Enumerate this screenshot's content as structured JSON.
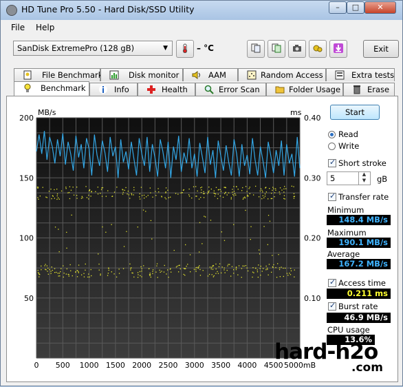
{
  "window": {
    "title": "HD Tune Pro 5.50 - Hard Disk/SSD Utility"
  },
  "menu": {
    "file": "File",
    "help": "Help"
  },
  "toolbar": {
    "drive": "SanDisk ExtremePro (128 gB)",
    "temperature": "– °C",
    "exit_label": "Exit",
    "icons": [
      "thermometer-icon",
      "copy-icon",
      "copy-info-icon",
      "camera-icon",
      "options-icon",
      "save-icon"
    ]
  },
  "tabs": {
    "row1": [
      {
        "label": "File Benchmark",
        "icon": "file-benchmark-icon"
      },
      {
        "label": "Disk monitor",
        "icon": "disk-monitor-icon"
      },
      {
        "label": "AAM",
        "icon": "speaker-icon"
      },
      {
        "label": "Random Access",
        "icon": "random-access-icon"
      },
      {
        "label": "Extra tests",
        "icon": "extra-tests-icon"
      }
    ],
    "row2": [
      {
        "label": "Benchmark",
        "icon": "benchmark-icon",
        "active": true
      },
      {
        "label": "Info",
        "icon": "info-icon"
      },
      {
        "label": "Health",
        "icon": "health-icon"
      },
      {
        "label": "Error Scan",
        "icon": "error-scan-icon"
      },
      {
        "label": "Folder Usage",
        "icon": "folder-icon"
      },
      {
        "label": "Erase",
        "icon": "erase-icon"
      }
    ]
  },
  "controls": {
    "start_label": "Start",
    "read_label": "Read",
    "write_label": "Write",
    "mode": "read",
    "short_stroke_label": "Short stroke",
    "short_stroke_checked": true,
    "short_stroke_value": "5",
    "short_stroke_unit": "gB",
    "transfer_rate_label": "Transfer rate",
    "transfer_rate_checked": true,
    "access_time_label": "Access time",
    "access_time_checked": true,
    "burst_rate_label": "Burst rate",
    "burst_rate_checked": true
  },
  "results": {
    "minimum_label": "Minimum",
    "minimum": "148.4 MB/s",
    "maximum_label": "Maximum",
    "maximum": "190.1 MB/s",
    "average_label": "Average",
    "average": "167.2 MB/s",
    "access_time": "0.211 ms",
    "burst_rate": "46.9 MB/s",
    "cpu_usage_label": "CPU usage",
    "cpu_usage": "13.6%"
  },
  "watermark": {
    "main": "hard-h2o",
    "sub": ".com"
  },
  "colors": {
    "transfer_line": "#33a7e6",
    "access_dots": "#e6e62e",
    "plot_bg_top": "#0f0f0f",
    "plot_bg_bottom": "#3c3c3c"
  },
  "chart_data": {
    "type": "line",
    "ylabel_left": "MB/s",
    "ylabel_right": "ms",
    "xlabel_unit": "mB",
    "x_ticks": [
      "0",
      "500",
      "1000",
      "1500",
      "2000",
      "2500",
      "3000",
      "3500",
      "4000",
      "4500",
      "5000mB"
    ],
    "y_left_ticks": [
      "200",
      "150",
      "100",
      "50"
    ],
    "y_right_ticks": [
      "0.40",
      "0.30",
      "0.20",
      "0.10"
    ],
    "xlim": [
      0,
      5000
    ],
    "ylim_left": [
      0,
      200
    ],
    "ylim_right": [
      0,
      0.4
    ],
    "grid": true,
    "series": [
      {
        "name": "Transfer rate",
        "axis": "left",
        "x": [
          0,
          50,
          100,
          150,
          200,
          250,
          300,
          350,
          400,
          450,
          500,
          550,
          600,
          650,
          700,
          750,
          800,
          850,
          900,
          950,
          1000,
          1050,
          1100,
          1150,
          1200,
          1250,
          1300,
          1350,
          1400,
          1450,
          1500,
          1550,
          1600,
          1650,
          1700,
          1750,
          1800,
          1850,
          1900,
          1950,
          2000,
          2050,
          2100,
          2150,
          2200,
          2250,
          2300,
          2350,
          2400,
          2450,
          2500,
          2550,
          2600,
          2650,
          2700,
          2750,
          2800,
          2850,
          2900,
          2950,
          3000,
          3050,
          3100,
          3150,
          3200,
          3250,
          3300,
          3350,
          3400,
          3450,
          3500,
          3550,
          3600,
          3650,
          3700,
          3750,
          3800,
          3850,
          3900,
          3950,
          4000,
          4050,
          4100,
          4150,
          4200,
          4250,
          4300,
          4350,
          4400,
          4450,
          4500,
          4550,
          4600,
          4650,
          4700,
          4750,
          4800,
          4850,
          4900,
          4950,
          5000
        ],
        "values": [
          172,
          186,
          170,
          189,
          165,
          184,
          176,
          162,
          182,
          168,
          187,
          161,
          180,
          170,
          156,
          185,
          167,
          178,
          158,
          183,
          174,
          152,
          186,
          169,
          160,
          181,
          171,
          155,
          184,
          168,
          176,
          150,
          182,
          163,
          172,
          157,
          180,
          166,
          152,
          183,
          170,
          160,
          184,
          155,
          178,
          167,
          151,
          182,
          172,
          158,
          180,
          150,
          176,
          165,
          185,
          155,
          171,
          162,
          183,
          158,
          170,
          151,
          179,
          167,
          154,
          184,
          161,
          173,
          150,
          181,
          168,
          156,
          177,
          163,
          152,
          182,
          170,
          151,
          178,
          160,
          169,
          153,
          183,
          165,
          152,
          176,
          164,
          150,
          180,
          168,
          154,
          173,
          160,
          181,
          152,
          178,
          162,
          170,
          151,
          184,
          158
        ]
      },
      {
        "name": "Access time",
        "axis": "right",
        "bands_ms": [
          [
            0.265,
            0.287
          ],
          [
            0.135,
            0.158
          ]
        ],
        "sparse_range_ms": [
          0.17,
          0.25
        ],
        "points_per_band": 230
      }
    ]
  }
}
